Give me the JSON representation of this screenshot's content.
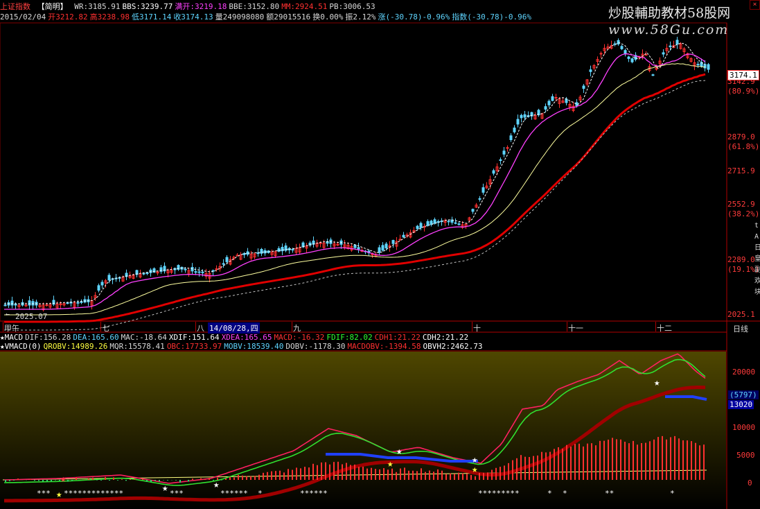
{
  "app": {
    "index_name": "上证指数",
    "mode_label": "【简明】",
    "close_icon": "close-icon"
  },
  "header": {
    "line1": [
      {
        "t": "WR:3185.91",
        "c": "#d8d8d8"
      },
      {
        "t": "BBS:3239.77",
        "c": "#ffffff"
      },
      {
        "t": "满开:3219.18",
        "c": "#ff40ff"
      },
      {
        "t": "BBE:3152.80",
        "c": "#d8d8d8"
      },
      {
        "t": "MM:2924.51",
        "c": "#ff3030"
      },
      {
        "t": "PB:3006.53",
        "c": "#d8d8d8"
      }
    ],
    "line2": [
      {
        "t": "2015/02/04",
        "c": "#d8d8d8"
      },
      {
        "t": "开3212.82",
        "c": "#ff3030"
      },
      {
        "t": "高3238.98",
        "c": "#ff3030"
      },
      {
        "t": "低3171.14",
        "c": "#5fd5ff"
      },
      {
        "t": "收3174.13",
        "c": "#5fd5ff"
      },
      {
        "t": "量249098080",
        "c": "#d8d8d8"
      },
      {
        "t": "额29015516",
        "c": "#d8d8d8"
      },
      {
        "t": "换0.00%",
        "c": "#d8d8d8"
      },
      {
        "t": "振2.12%",
        "c": "#d8d8d8"
      },
      {
        "t": "涨(-30.78)-0.96%",
        "c": "#5fd5ff"
      },
      {
        "t": "指数(-30.78)-0.96%",
        "c": "#5fd5ff"
      }
    ]
  },
  "watermark": {
    "line1": "炒股輔助教材58股网",
    "line2": "www.58Gu.com"
  },
  "price_axis": {
    "current": "3174.1",
    "labels": [
      {
        "v": "3142.9",
        "c": "#ff3b3b"
      },
      {
        "v": "(80.9%)",
        "c": "#ff3b3b"
      },
      {
        "v": "2879.0",
        "c": "#ff3b3b"
      },
      {
        "v": "(61.8%)",
        "c": "#ff3b3b"
      },
      {
        "v": "2715.9",
        "c": "#ff3b3b"
      },
      {
        "v": "2552.9",
        "c": "#ff3b3b"
      },
      {
        "v": "(38.2%)",
        "c": "#ff3b3b"
      },
      {
        "v": "2289.0",
        "c": "#ff3b3b"
      },
      {
        "v": "(19.1%)",
        "c": "#ff3b3b"
      },
      {
        "v": "2025.1",
        "c": "#ff3b3b"
      }
    ],
    "low_marker": "2025.07"
  },
  "time_axis": {
    "labels": [
      "甲午",
      "七",
      "八",
      "九",
      "十",
      "十一",
      "十二"
    ],
    "cursor": "14/08/28,四",
    "period_button": "日线"
  },
  "indicator_lines": {
    "macd": [
      {
        "t": "★MACD",
        "c": "#ffffff"
      },
      {
        "t": "DIF:156.28",
        "c": "#d8d8d8"
      },
      {
        "t": "DEA:165.60",
        "c": "#5fd5ff"
      },
      {
        "t": "MAC:-18.64",
        "c": "#d8d8d8"
      },
      {
        "t": "XDIF:151.64",
        "c": "#ffffff"
      },
      {
        "t": "XDEA:165.65",
        "c": "#ff40ff"
      },
      {
        "t": "MACD:-16.32",
        "c": "#ff3030"
      },
      {
        "t": "FDIF:82.02",
        "c": "#30ff30"
      },
      {
        "t": "CDH1:21.22",
        "c": "#ff3030"
      },
      {
        "t": "CDH2:21.22",
        "c": "#ffffff"
      }
    ],
    "vmacd": [
      {
        "t": "★VMACD(0)",
        "c": "#ffffff"
      },
      {
        "t": "QROBV:14989.26",
        "c": "#ffff40"
      },
      {
        "t": "MQR:15578.41",
        "c": "#d8d8d8"
      },
      {
        "t": "OBC:17733.97",
        "c": "#ff3030"
      },
      {
        "t": "MOBV:18539.40",
        "c": "#5fd5ff"
      },
      {
        "t": "DOBV:-1178.30",
        "c": "#d8d8d8"
      },
      {
        "t": "MACDOBV:-1394.58",
        "c": "#ff3030"
      },
      {
        "t": "OBVH2:2462.73",
        "c": "#ffffff"
      }
    ]
  },
  "lower_axis": {
    "labels": [
      "20000",
      "10000",
      "5000",
      "0"
    ],
    "box1": "(5797)",
    "box2": "13020"
  },
  "colors": {
    "up": "#ff3030",
    "down": "#5fd5ff",
    "ma_white": "#ffffff",
    "ma_magenta": "#ff40ff",
    "ma_yellow": "#ffffa0",
    "ma_red": "#e00000",
    "ma_green": "#30d030",
    "panel_bg_top": "#4a4400",
    "panel_bg_bottom": "#000000"
  }
}
